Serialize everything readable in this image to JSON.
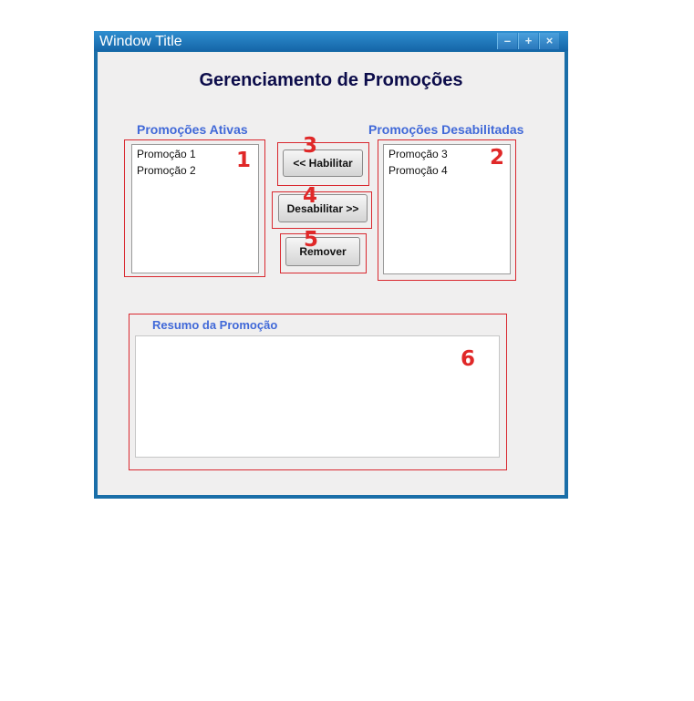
{
  "window": {
    "title": "Window Title",
    "controls": {
      "minimize": "–",
      "maximize": "+",
      "close": "×"
    }
  },
  "page": {
    "heading": "Gerenciamento de Promoções"
  },
  "active_list": {
    "label": "Promoções Ativas",
    "items": [
      "Promoção 1",
      "Promoção 2"
    ]
  },
  "disabled_list": {
    "label": "Promoções Desabilitadas",
    "items": [
      "Promoção 3",
      "Promoção 4"
    ]
  },
  "buttons": {
    "enable": "<< Habilitar",
    "disable": "Desabilitar >>",
    "remove": "Remover"
  },
  "summary": {
    "label": "Resumo da Promoção",
    "text": ""
  },
  "annotations": {
    "n1": "1",
    "n2": "2",
    "n3": "3",
    "n4": "4",
    "n5": "5",
    "n6": "6"
  },
  "colors": {
    "title_bar": "#1a6ea8",
    "heading": "#0c0c4a",
    "group_label": "#4169d8",
    "annotation": "#e02828",
    "window_bg": "#f0efef"
  }
}
